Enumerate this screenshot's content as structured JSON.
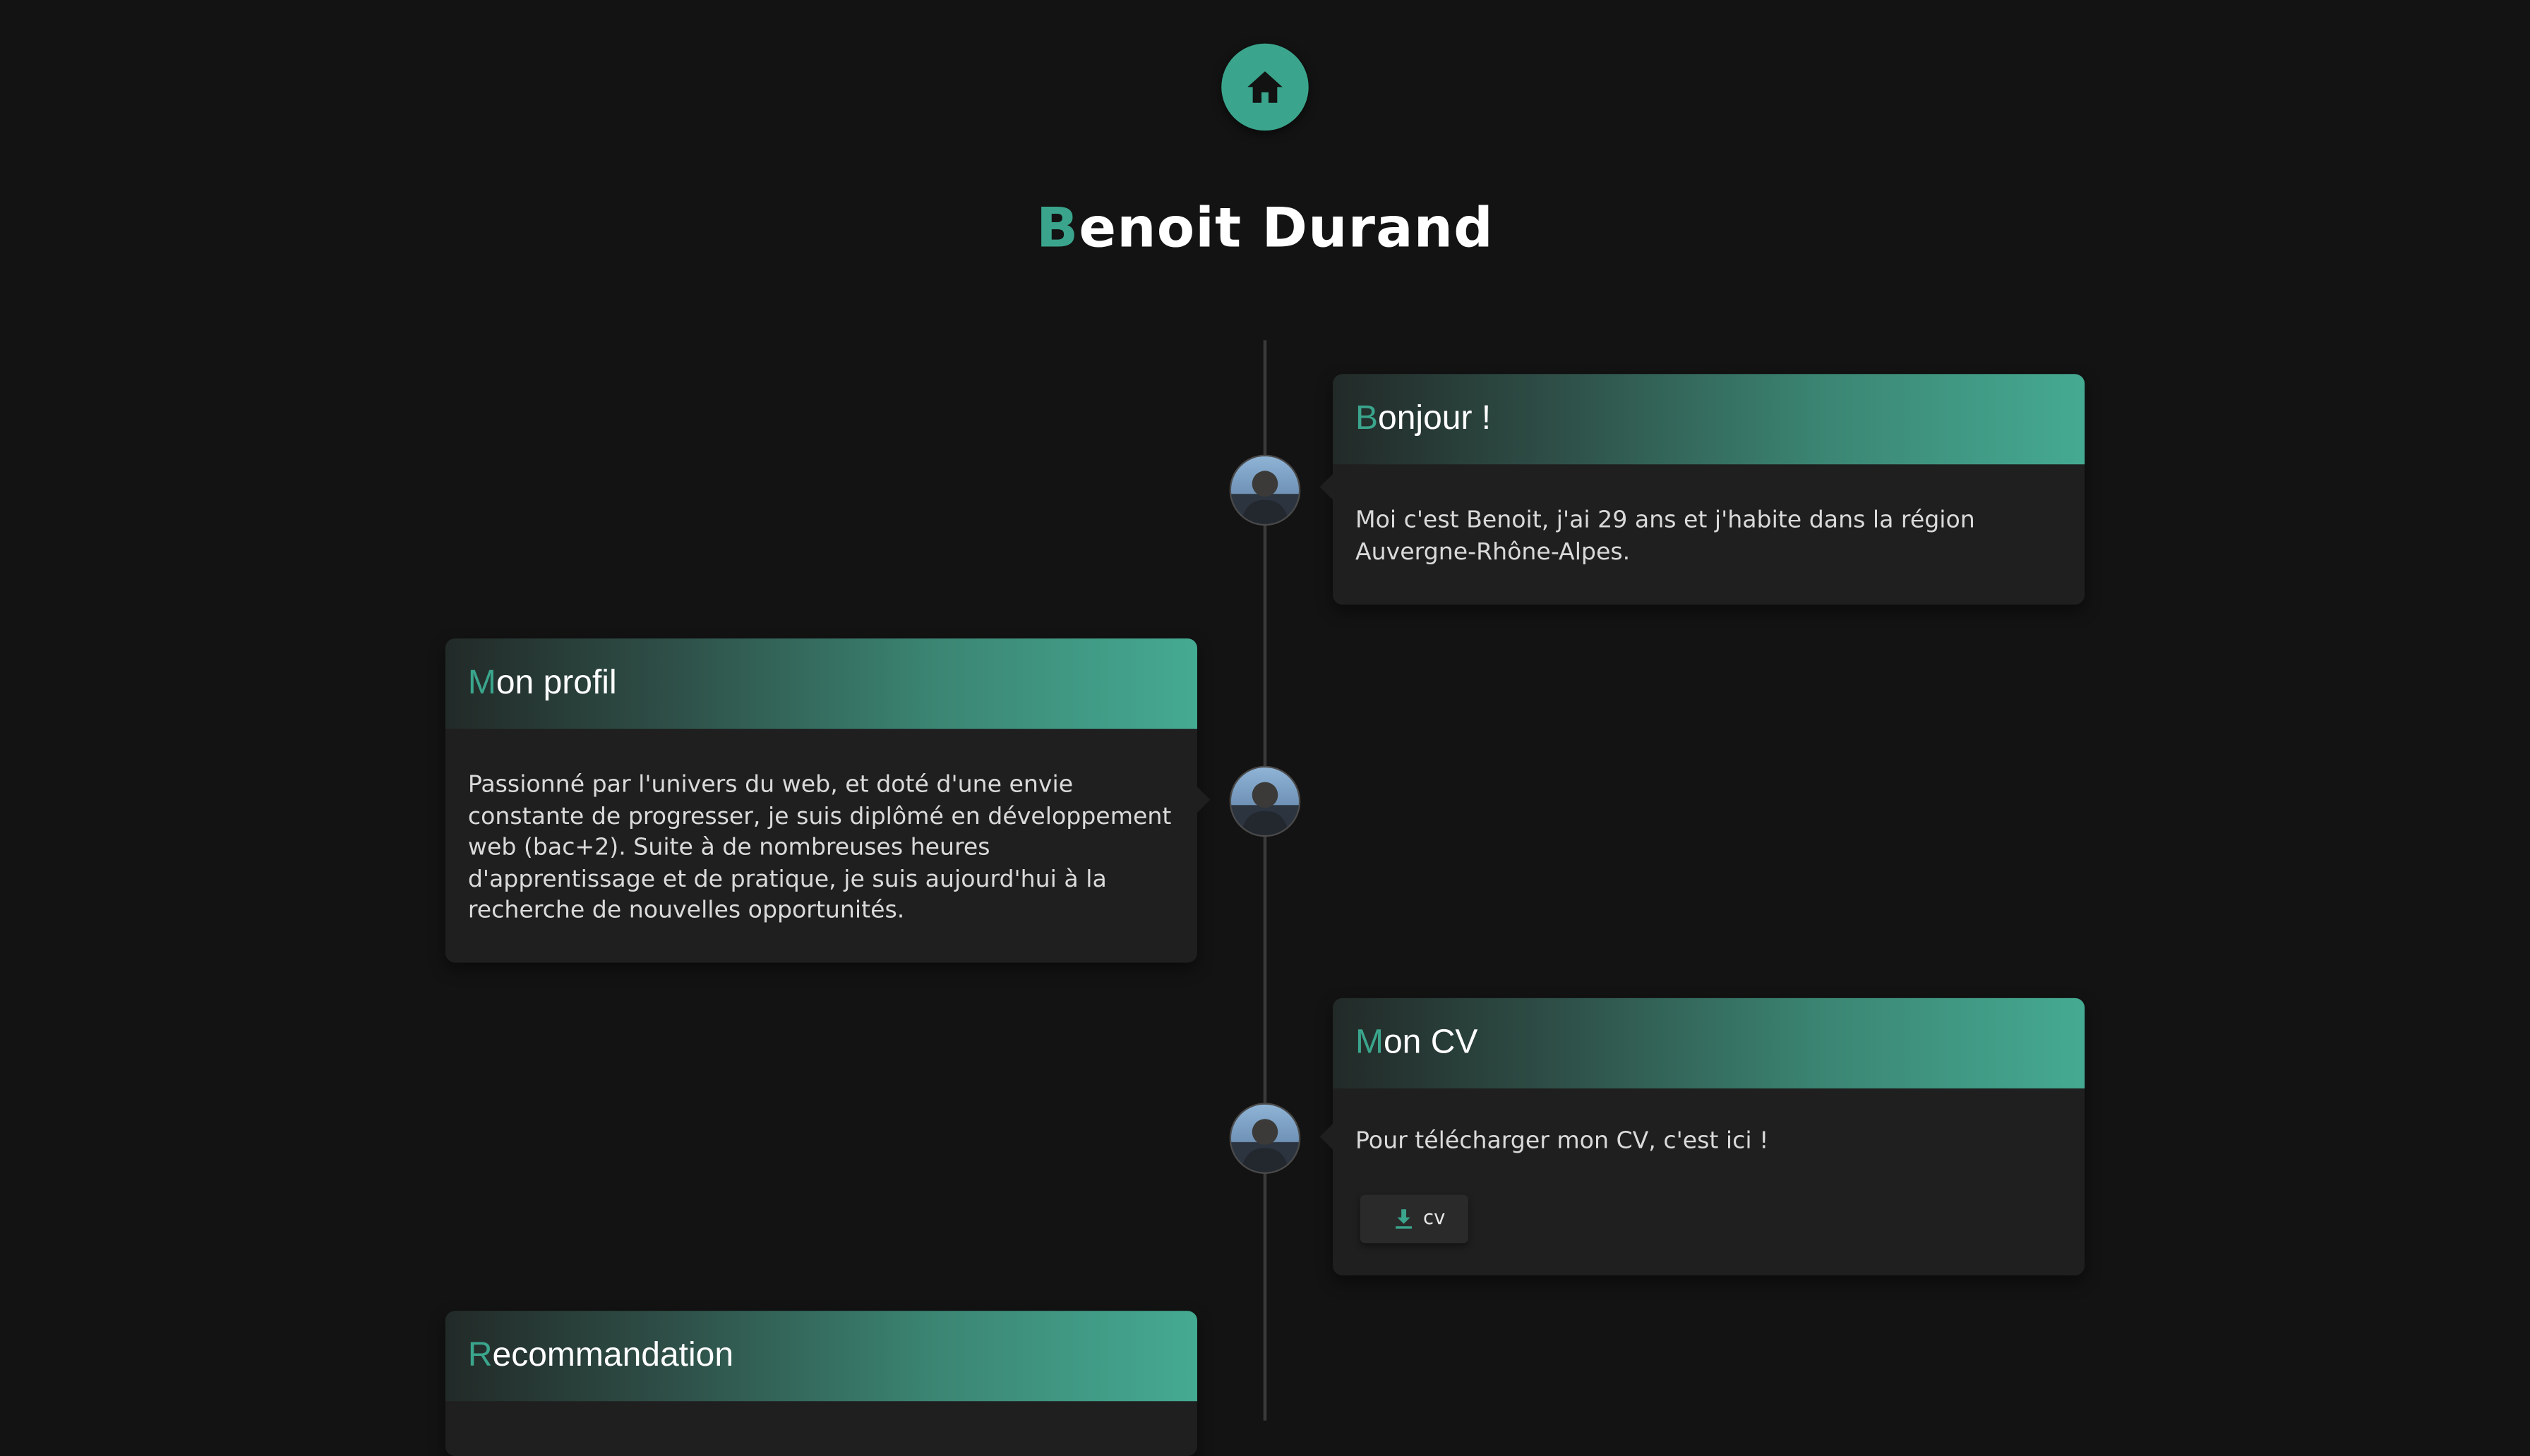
{
  "header": {
    "home_icon": "home-icon",
    "title_initial": "B",
    "title_rest": "enoit Durand"
  },
  "colors": {
    "accent": "#3aa58c",
    "background": "#131313",
    "card": "#1f1f1f"
  },
  "timeline": [
    {
      "title_initial": "B",
      "title_rest": "onjour !",
      "text": "Moi c'est Benoit, j'ai 29 ans et j'habite dans la région Auvergne-Rhône-Alpes."
    },
    {
      "title_initial": "M",
      "title_rest": "on profil",
      "text": "Passionné par l'univers du web, et doté d'une envie constante de progresser, je suis diplômé en développement web (bac+2). Suite à de nombreuses heures d'apprentissage et de pratique, je suis aujourd'hui à la recherche de nouvelles opportunités."
    },
    {
      "title_initial": "M",
      "title_rest": "on CV",
      "text": "Pour télécharger mon CV, c'est ici !",
      "button_label": "cv",
      "button_icon": "download-icon"
    },
    {
      "title_initial": "R",
      "title_rest": "ecommandation"
    }
  ]
}
